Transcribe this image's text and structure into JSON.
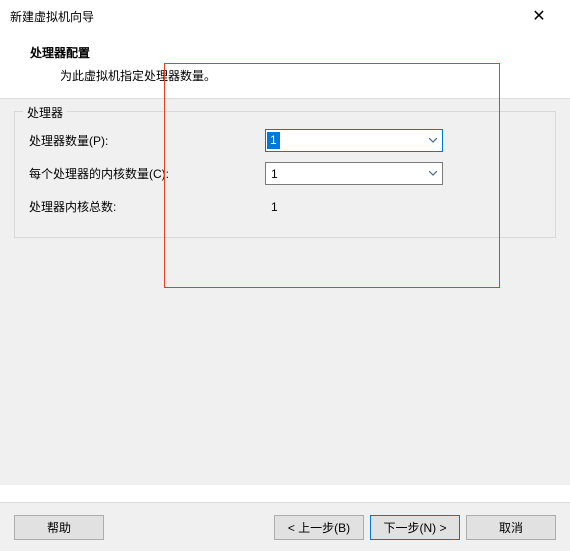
{
  "titlebar": {
    "title": "新建虚拟机向导"
  },
  "header": {
    "title": "处理器配置",
    "subtitle": "为此虚拟机指定处理器数量。"
  },
  "group": {
    "legend": "处理器",
    "rows": {
      "processors": {
        "label": "处理器数量(P):",
        "value": "1"
      },
      "coresPerProcessor": {
        "label": "每个处理器的内核数量(C):",
        "value": "1"
      },
      "totalCores": {
        "label": "处理器内核总数:",
        "value": "1"
      }
    }
  },
  "footer": {
    "help": "帮助",
    "back": "< 上一步(B)",
    "next": "下一步(N) >",
    "cancel": "取消"
  }
}
